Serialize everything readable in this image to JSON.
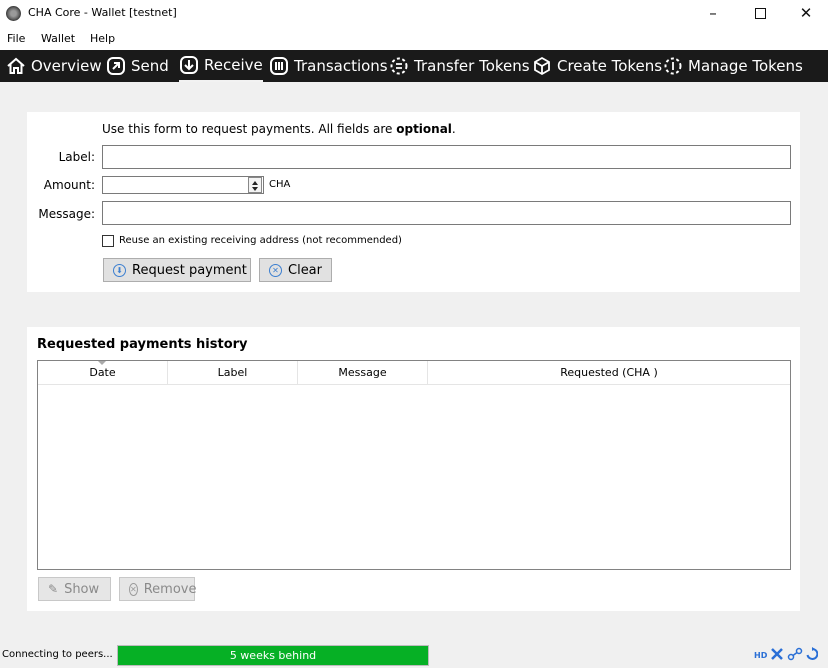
{
  "window": {
    "title": "CHA Core - Wallet [testnet]"
  },
  "menu": [
    "File",
    "Wallet",
    "Help"
  ],
  "toolbar": {
    "overview": "Overview",
    "send": "Send",
    "receive": "Receive",
    "transactions": "Transactions",
    "transfer_tokens": "Transfer Tokens",
    "create_tokens": "Create Tokens",
    "manage_tokens": "Manage Tokens",
    "active": "receive"
  },
  "form": {
    "intro_prefix": "Use this form to request payments. All fields are ",
    "intro_bold": "optional",
    "intro_suffix": ".",
    "label_label": "Label:",
    "label_value": "",
    "amount_label": "Amount:",
    "amount_value": "",
    "amount_unit": "CHA",
    "message_label": "Message:",
    "message_value": "",
    "reuse_checkbox": "Reuse an existing receiving address (not recommended)",
    "reuse_checked": false,
    "request_button": "Request payment",
    "clear_button": "Clear"
  },
  "history": {
    "title": "Requested payments history",
    "columns": [
      "Date",
      "Label",
      "Message",
      "Requested (CHA )"
    ],
    "rows": [],
    "show_button": "Show",
    "remove_button": "Remove"
  },
  "status": {
    "text": "Connecting to peers...",
    "progress_text": "5 weeks behind",
    "progress_fraction": 1.0,
    "hd_label": "HD"
  },
  "colors": {
    "accent": "#3c7fd0",
    "progress": "#06b025",
    "toolbar_bg": "#1a1a1a"
  }
}
